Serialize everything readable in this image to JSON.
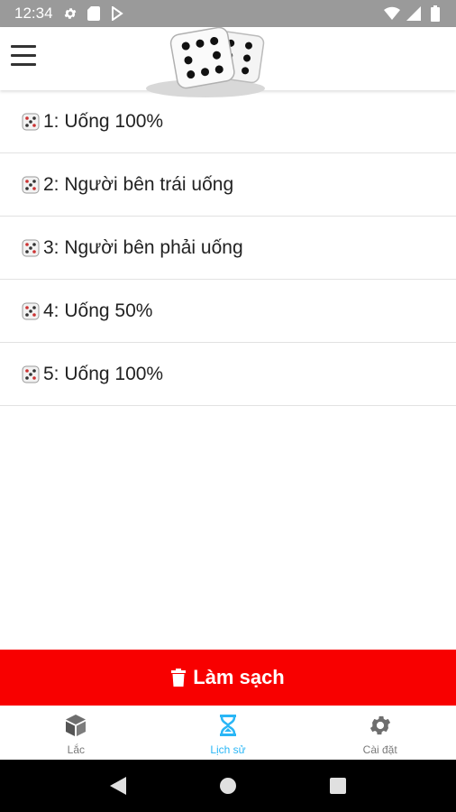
{
  "status_bar": {
    "time": "12:34",
    "left_icons": [
      "gear-icon",
      "sd-card-icon",
      "play-store-icon"
    ],
    "right_icons": [
      "wifi-icon",
      "signal-icon",
      "battery-icon"
    ]
  },
  "app_bar": {
    "menu_icon": "hamburger-icon",
    "logo": "dice-logo"
  },
  "history": {
    "items": [
      {
        "label": "1: Uống 100%"
      },
      {
        "label": "2: Người bên trái uống"
      },
      {
        "label": "3: Người bên phải uống"
      },
      {
        "label": "4: Uống 50%"
      },
      {
        "label": "5: Uống 100%"
      }
    ]
  },
  "clear_button": {
    "label": "Làm sạch",
    "color": "#f80000"
  },
  "bottom_nav": {
    "tabs": [
      {
        "label": "Lắc",
        "icon": "cube-icon"
      },
      {
        "label": "Lịch sử",
        "icon": "hourglass-icon",
        "active": true
      },
      {
        "label": "Cài đặt",
        "icon": "settings-icon"
      }
    ],
    "active_color": "#29b6f6"
  },
  "system_nav": {
    "buttons": [
      "back-icon",
      "home-icon",
      "recents-icon"
    ]
  }
}
